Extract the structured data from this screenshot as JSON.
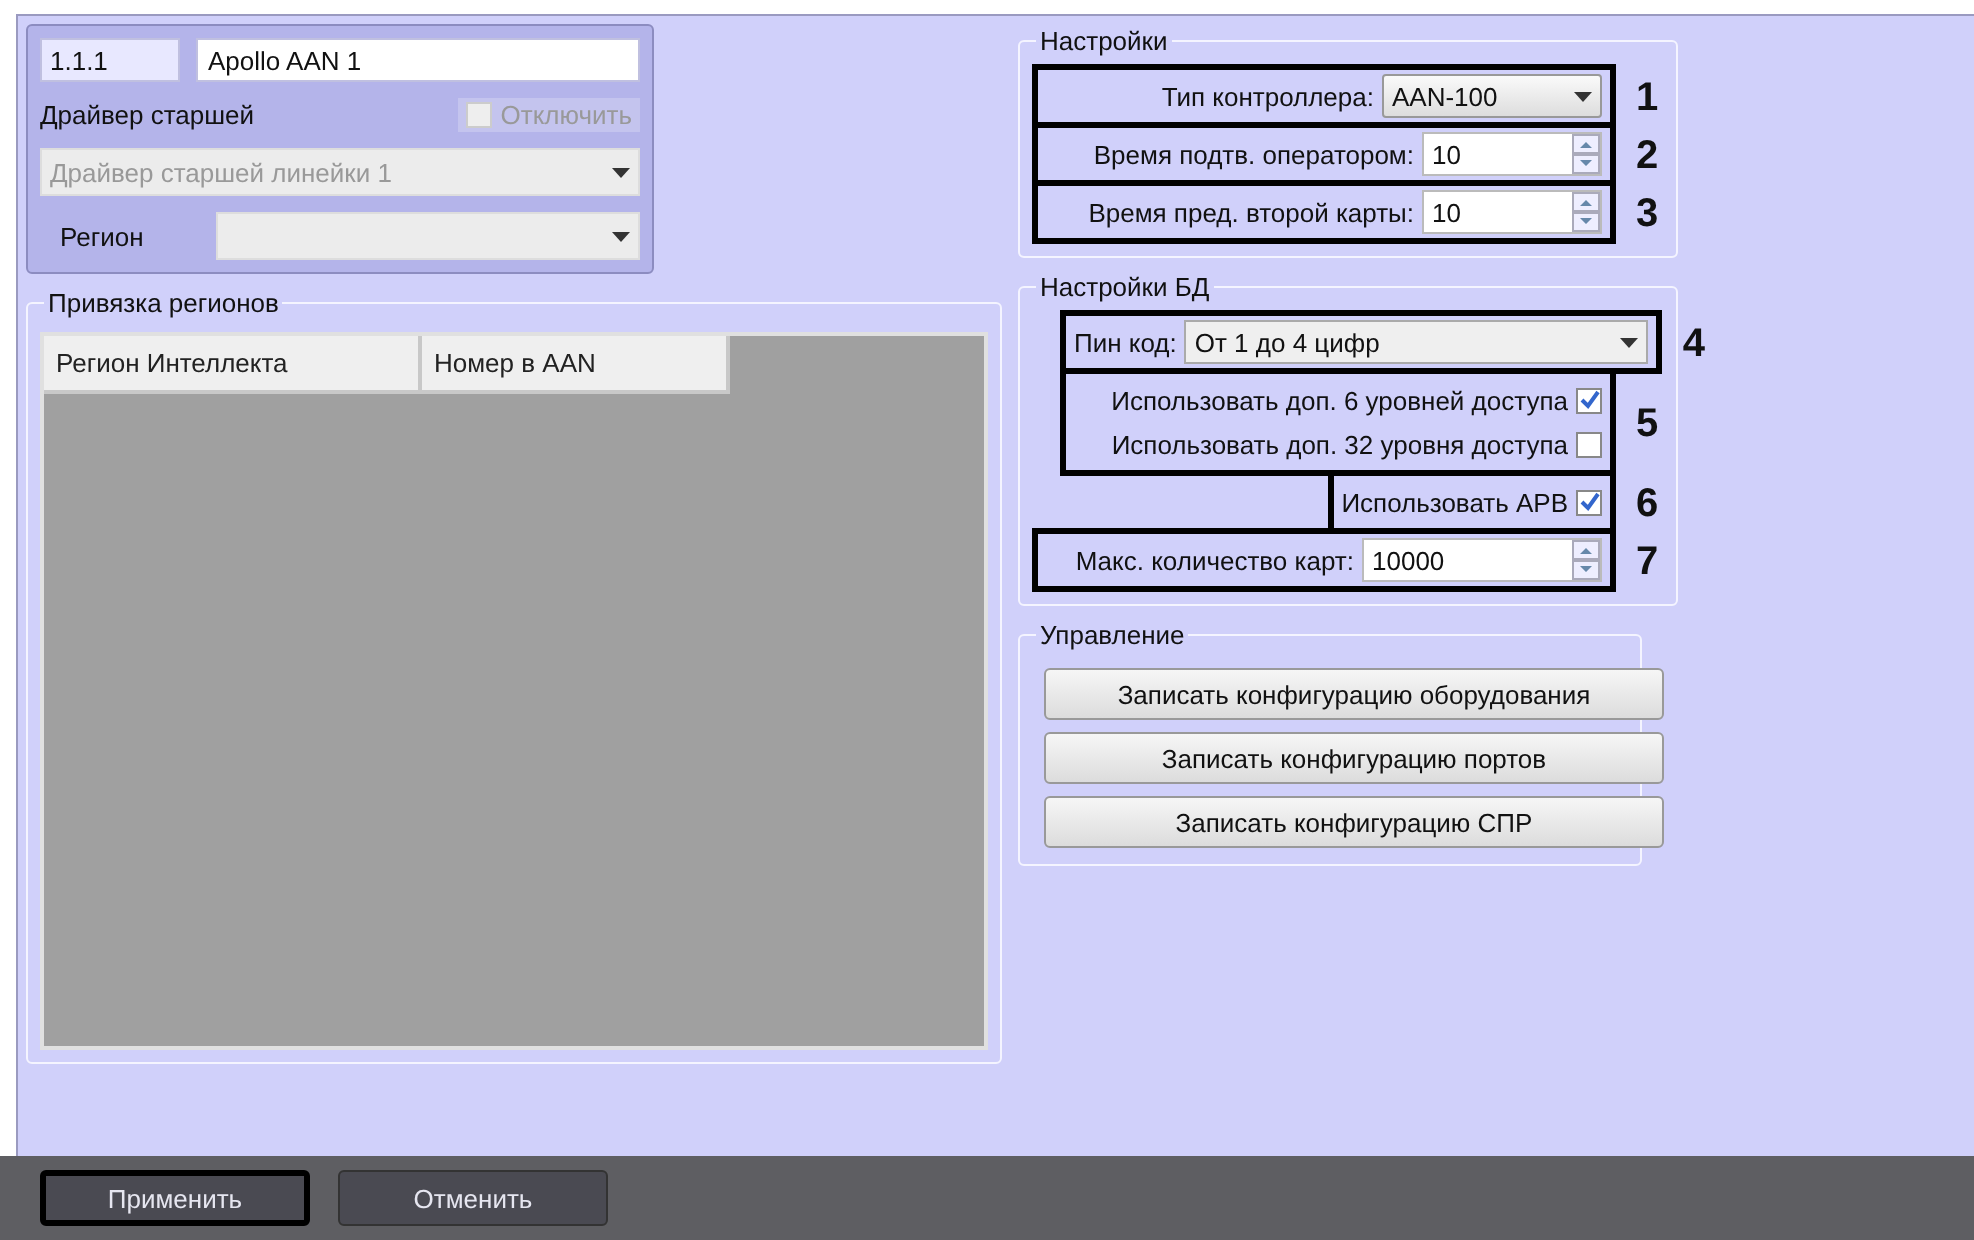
{
  "header": {
    "code": "1.1.1",
    "name": "Apollo AAN 1",
    "driver_label": "Драйвер старшей",
    "disable": {
      "label": "Отключить",
      "checked": false,
      "disabled": true
    },
    "driver_select": {
      "value": "Драйвер старшей линейки 1",
      "disabled": true
    },
    "region_label": "Регион",
    "region_select": {
      "disabled": true
    }
  },
  "regions": {
    "title": "Привязка регионов",
    "columns": [
      "Регион Интеллекта",
      "Номер в AAN"
    ]
  },
  "settings": {
    "title": "Настройки",
    "frames": [
      {
        "marker": "1",
        "items": [
          {
            "kind": "select",
            "label": "Тип контроллера:",
            "value": "AAN-100"
          }
        ]
      },
      {
        "marker": "2",
        "items": [
          {
            "kind": "spin",
            "label": "Время подтв. оператором:",
            "value": "10"
          }
        ]
      },
      {
        "marker": "3",
        "items": [
          {
            "kind": "spin",
            "label": "Время  пред. второй карты:",
            "value": "10"
          }
        ]
      }
    ]
  },
  "db_settings": {
    "title": "Настройки БД",
    "frames": [
      {
        "marker": "4",
        "items": [
          {
            "kind": "wide-select",
            "label": "Пин код:",
            "value": "От 1 до 4 цифр"
          }
        ]
      },
      {
        "marker": "5",
        "items": [
          {
            "kind": "check",
            "label": "Использовать доп. 6 уровней доступа",
            "checked": true
          },
          {
            "kind": "check",
            "label": "Использовать доп. 32 уровня доступа",
            "checked": false
          }
        ]
      },
      {
        "marker": "6",
        "items": [
          {
            "kind": "check",
            "label": "Использовать APB",
            "checked": true
          }
        ]
      },
      {
        "marker": "7",
        "items": [
          {
            "kind": "spin",
            "label": "Макс. количество карт:",
            "value": "10000"
          }
        ]
      }
    ]
  },
  "control": {
    "title": "Управление",
    "buttons": [
      "Записать конфигурацию оборудования",
      "Записать конфигурацию портов",
      "Записать конфигурацию СПР"
    ]
  },
  "footer": {
    "buttons": [
      {
        "label": "Применить",
        "selected": true
      },
      {
        "label": "Отменить",
        "selected": false
      }
    ]
  }
}
